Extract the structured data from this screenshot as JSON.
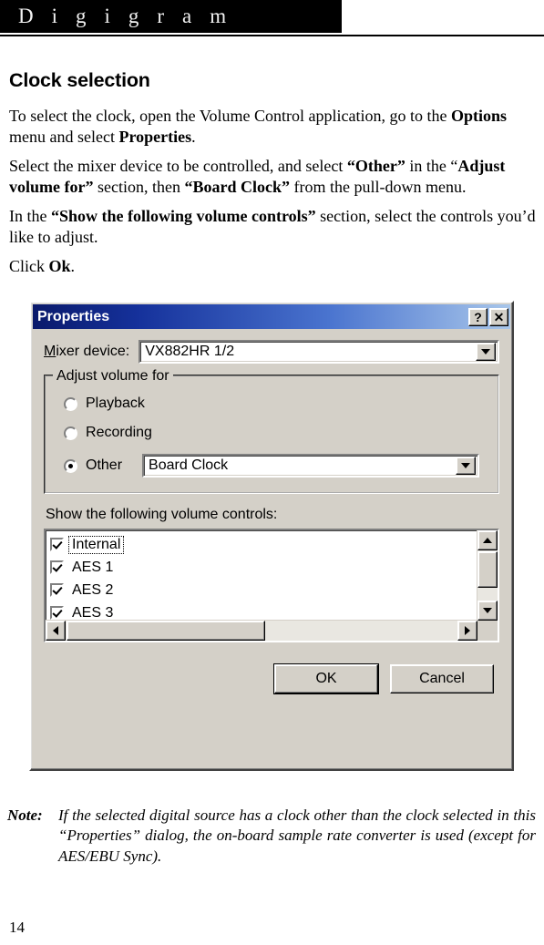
{
  "header": {
    "brand": "Digigram"
  },
  "doc": {
    "section_title": "Clock selection",
    "paragraphs": [
      {
        "parts": [
          {
            "t": "To select the clock, open the Volume Control application, go to the ",
            "b": false
          },
          {
            "t": "Options",
            "b": true
          },
          {
            "t": " menu and select ",
            "b": false
          },
          {
            "t": "Properties",
            "b": true
          },
          {
            "t": ".",
            "b": false
          }
        ]
      },
      {
        "parts": [
          {
            "t": "Select the mixer device to be controlled, and select ",
            "b": false
          },
          {
            "t": "“Other”",
            "b": true
          },
          {
            "t": " in the “",
            "b": false
          },
          {
            "t": "Adjust volume for”",
            "b": true
          },
          {
            "t": " section, then ",
            "b": false
          },
          {
            "t": "“Board Clock”",
            "b": true
          },
          {
            "t": " from the pull-down menu.",
            "b": false
          }
        ]
      },
      {
        "parts": [
          {
            "t": "In the ",
            "b": false
          },
          {
            "t": "“Show the following volume controls”",
            "b": true
          },
          {
            "t": " section, select the controls you’d like to adjust.",
            "b": false
          }
        ]
      },
      {
        "parts": [
          {
            "t": "Click ",
            "b": false
          },
          {
            "t": "Ok",
            "b": true
          },
          {
            "t": ".",
            "b": false
          }
        ]
      }
    ]
  },
  "dialog": {
    "title": "Properties",
    "titlebar_buttons": {
      "help": "?",
      "close": "✕"
    },
    "mixer_device": {
      "label_prefix": "M",
      "label_rest": "ixer device:",
      "value": "VX882HR 1/2"
    },
    "adjust_group": {
      "title": "Adjust volume for",
      "options": [
        {
          "accel": "P",
          "rest": "layback",
          "selected": false
        },
        {
          "accel": "R",
          "rest": "ecording",
          "selected": false
        },
        {
          "accel": "O",
          "rest": "ther",
          "selected": true
        }
      ],
      "other_value": "Board Clock"
    },
    "controls_list": {
      "caption_a": "Show the follo",
      "caption_accel": "w",
      "caption_b": "ing volume controls:",
      "items": [
        {
          "label": "Internal",
          "checked": true,
          "focused": true
        },
        {
          "label": "AES 1",
          "checked": true,
          "focused": false
        },
        {
          "label": "AES 2",
          "checked": true,
          "focused": false
        },
        {
          "label": "AES 3",
          "checked": true,
          "focused": false
        }
      ]
    },
    "buttons": {
      "ok": "OK",
      "cancel": "Cancel"
    },
    "colors": {
      "face": "#d4d0c8",
      "title_left": "#0a1a6b",
      "title_right": "#a8c6ea",
      "field_bg": "#ffffff"
    }
  },
  "note": {
    "label": "Note:",
    "text": "If the selected digital source has a clock other than the clock selected in this “Properties” dialog, the on-board sample rate converter is used (except for AES/EBU Sync)."
  },
  "page_number": "14"
}
